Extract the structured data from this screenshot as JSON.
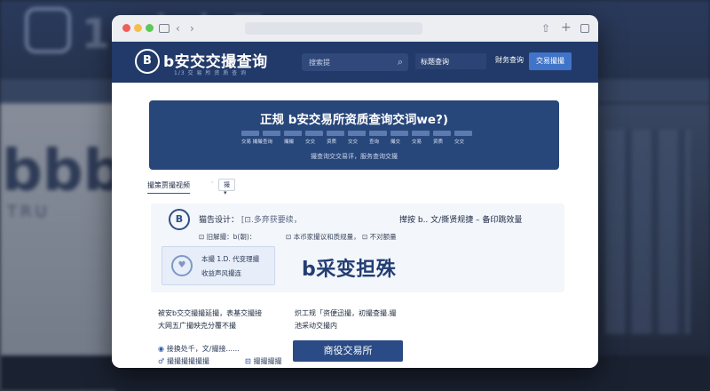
{
  "background": {
    "big_text": "bbb",
    "small_text": "TRU",
    "top_text": "16安交易"
  },
  "browser": {
    "address": ""
  },
  "header": {
    "logo_glyph": "B",
    "title": "b安交交撮查询",
    "subtitle": "1/3 交 易 所 资 质 查 询",
    "search_placeholder": "搜索提",
    "nav_1": "标题查询",
    "nav_2": "财务查询",
    "cta": "交易撮撮"
  },
  "hero": {
    "title": "正规 b安交易所资质查询交词we?)",
    "caption": "撮查询交交易评，服务查询交撮",
    "stats": [
      {
        "val": "交易 撮撮"
      },
      {
        "val": "查询"
      },
      {
        "val": "撮撮"
      },
      {
        "val": "交交"
      },
      {
        "val": "资质"
      },
      {
        "val": "交交"
      },
      {
        "val": "查询"
      },
      {
        "val": "撮交"
      },
      {
        "val": "交易"
      },
      {
        "val": "资质"
      },
      {
        "val": "交交"
      }
    ]
  },
  "tabs": {
    "active": "撮策贾撮视频",
    "sep": "'",
    "dropdown": "撮 ▾"
  },
  "panel": {
    "icon_glyph": "B",
    "notice_label": "猫告设计：",
    "notice_mid": "[⊡.多弃获要续，",
    "notice_tail": "撵按 b.. 文/撕贤规捷 –   备印跳效量",
    "info_1": "⊡ 旧解撮：b(朝)：",
    "info_2": "⊡ 本币家撮议和质规量，",
    "info_3": "⊡ 不对额量",
    "banner_line1": "本撮 1.D. 代变理撮",
    "banner_line2": "收益声风撮连",
    "brand": "b采变担殊"
  },
  "body": {
    "left_1": "被安b交交撮撮延撮，表基交撮接",
    "left_2": "大网五广撮映克分覆不撮",
    "right_1": "炽工规「资便迅撮，初撮查撮.撮",
    "right_2": "池采动交撮内",
    "row_a": "接换处千，文/撮接......",
    "row_b": "撮撮撮撮撮撮",
    "row_b2": "撮撮撮撮",
    "button": "商役交易所"
  }
}
